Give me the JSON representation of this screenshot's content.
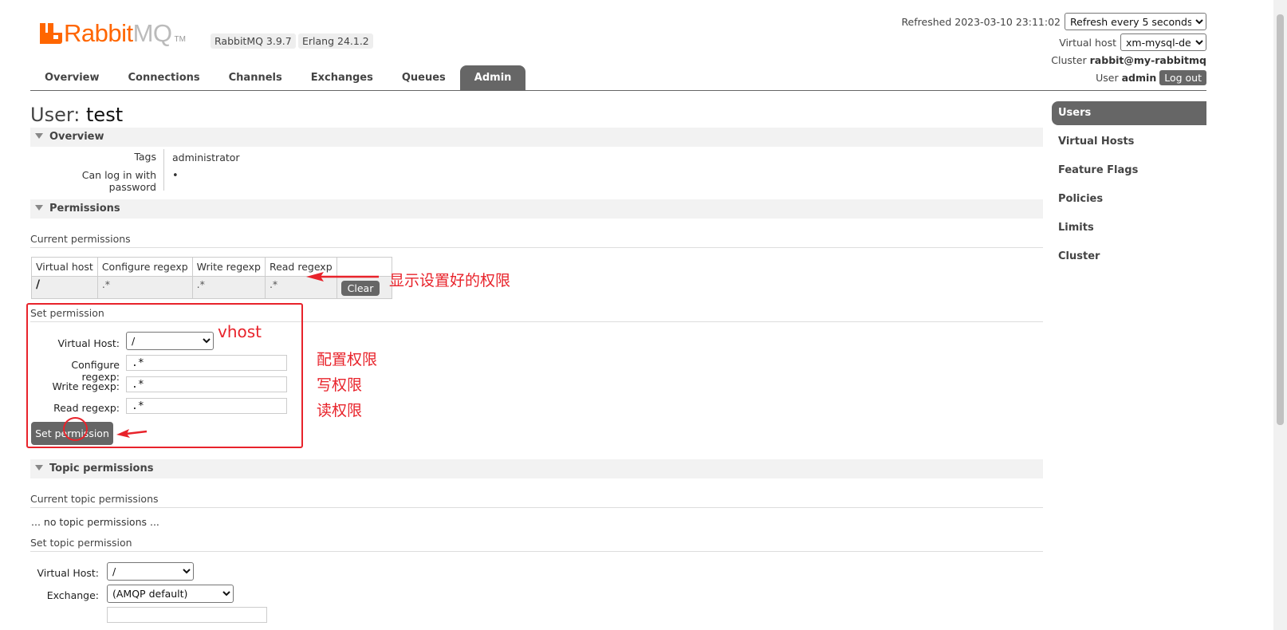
{
  "header": {
    "logo_rabbit": "Rabbit",
    "logo_mq": "MQ",
    "logo_tm": "TM",
    "version": "RabbitMQ 3.9.7",
    "erlang": "Erlang 24.1.2",
    "refreshed_label": "Refreshed 2023-03-10 23:11:02",
    "refresh_select": "Refresh every 5 seconds",
    "vhost_label": "Virtual host",
    "vhost_select": "xm-mysql-dev",
    "cluster_label": "Cluster",
    "cluster_name": "rabbit@my-rabbitmq",
    "user_label": "User",
    "user_name": "admin",
    "logout": "Log out"
  },
  "tabs": [
    "Overview",
    "Connections",
    "Channels",
    "Exchanges",
    "Queues",
    "Admin"
  ],
  "sidebar": [
    "Users",
    "Virtual Hosts",
    "Feature Flags",
    "Policies",
    "Limits",
    "Cluster"
  ],
  "page": {
    "title_prefix": "User:",
    "title_name": "test"
  },
  "overview": {
    "heading": "Overview",
    "tags_label": "Tags",
    "tags_value": "administrator",
    "login_label": "Can log in with password",
    "login_value": "•"
  },
  "permissions": {
    "heading": "Permissions",
    "current_heading": "Current permissions",
    "columns": [
      "Virtual host",
      "Configure regexp",
      "Write regexp",
      "Read regexp"
    ],
    "row": [
      "/",
      ".*",
      ".*",
      ".*"
    ],
    "clear": "Clear",
    "set_heading": "Set permission",
    "vhost_label": "Virtual Host:",
    "vhost_value": "/",
    "configure_label": "Configure regexp:",
    "configure_value": ".*",
    "write_label": "Write regexp:",
    "write_value": ".*",
    "read_label": "Read regexp:",
    "read_value": ".*",
    "submit": "Set permission"
  },
  "topic": {
    "heading": "Topic permissions",
    "current_heading": "Current topic permissions",
    "none": "... no topic permissions ...",
    "set_heading": "Set topic permission",
    "vhost_label": "Virtual Host:",
    "vhost_value": "/",
    "exchange_label": "Exchange:",
    "exchange_value": "(AMQP default)"
  },
  "annotations": {
    "shown": "显示设置好的权限",
    "vhost": "vhost",
    "configure": "配置权限",
    "write": "写权限",
    "read": "读权限"
  },
  "colors": {
    "brand": "#ff6600",
    "tab_active": "#666666",
    "annotation": "#e8232b"
  }
}
